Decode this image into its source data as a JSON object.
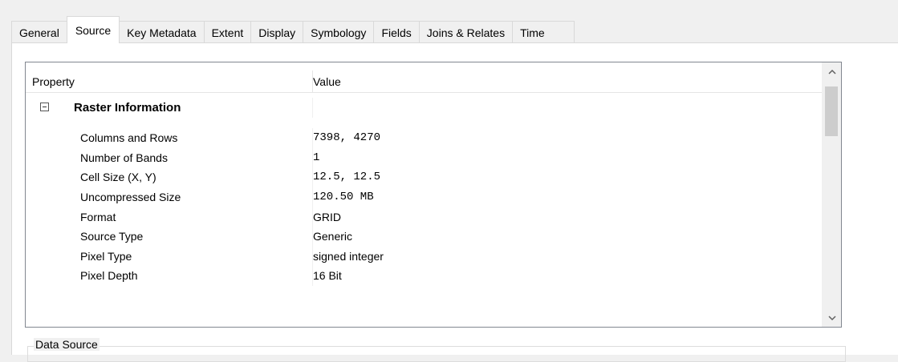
{
  "tabs": [
    {
      "label": "General"
    },
    {
      "label": "Source"
    },
    {
      "label": "Key Metadata"
    },
    {
      "label": "Extent"
    },
    {
      "label": "Display"
    },
    {
      "label": "Symbology"
    },
    {
      "label": "Fields"
    },
    {
      "label": "Joins & Relates"
    },
    {
      "label": "Time"
    }
  ],
  "active_tab": "Source",
  "grid": {
    "header": {
      "property": "Property",
      "value": "Value"
    },
    "category": {
      "label": "Raster Information",
      "expanded": true
    },
    "rows": [
      {
        "property": "Columns and Rows",
        "value": "7398, 4270"
      },
      {
        "property": "Number of Bands",
        "value": "1"
      },
      {
        "property": "Cell Size (X, Y)",
        "value": "12.5, 12.5"
      },
      {
        "property": "Uncompressed Size",
        "value": "120.50 MB"
      },
      {
        "property": "Format",
        "value": "GRID"
      },
      {
        "property": "Source Type",
        "value": "Generic"
      },
      {
        "property": "Pixel Type",
        "value": "signed integer"
      },
      {
        "property": "Pixel Depth",
        "value": "16 Bit"
      }
    ]
  },
  "data_source_label": "Data Source",
  "icons": {
    "collapse": "minus-box-icon",
    "scroll_up": "chevron-up-icon",
    "scroll_down": "chevron-down-icon"
  }
}
